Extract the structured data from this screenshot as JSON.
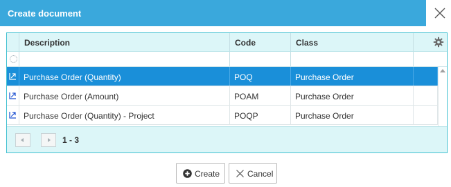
{
  "dialog": {
    "title": "Create document"
  },
  "grid": {
    "columns": [
      "Description",
      "Code",
      "Class"
    ],
    "rows": [
      {
        "description": "Purchase Order (Quantity)",
        "code": "POQ",
        "class": "Purchase Order",
        "selected": true
      },
      {
        "description": "Purchase Order (Amount)",
        "code": "POAM",
        "class": "Purchase Order",
        "selected": false
      },
      {
        "description": "Purchase Order (Quantity) - Project",
        "code": "POQP",
        "class": "Purchase Order",
        "selected": false
      }
    ],
    "pager": {
      "range": "1 - 3"
    }
  },
  "footer": {
    "create_label": "Create",
    "cancel_label": "Cancel"
  },
  "colors": {
    "titlebar": "#3aa8dc",
    "grid_border": "#3fc0d0",
    "grid_bg": "#dcf6f8",
    "selected_row": "#1a8fd9"
  },
  "icons": {
    "close": "close-icon",
    "settings": "gear-icon",
    "filter_loading": "loading-icon",
    "filter_popout": "popout-icon",
    "row_document": "document-link-icon",
    "pager_prev": "prev-page-icon",
    "pager_next": "next-page-icon",
    "create": "plus-circle-icon",
    "cancel": "x-icon"
  }
}
